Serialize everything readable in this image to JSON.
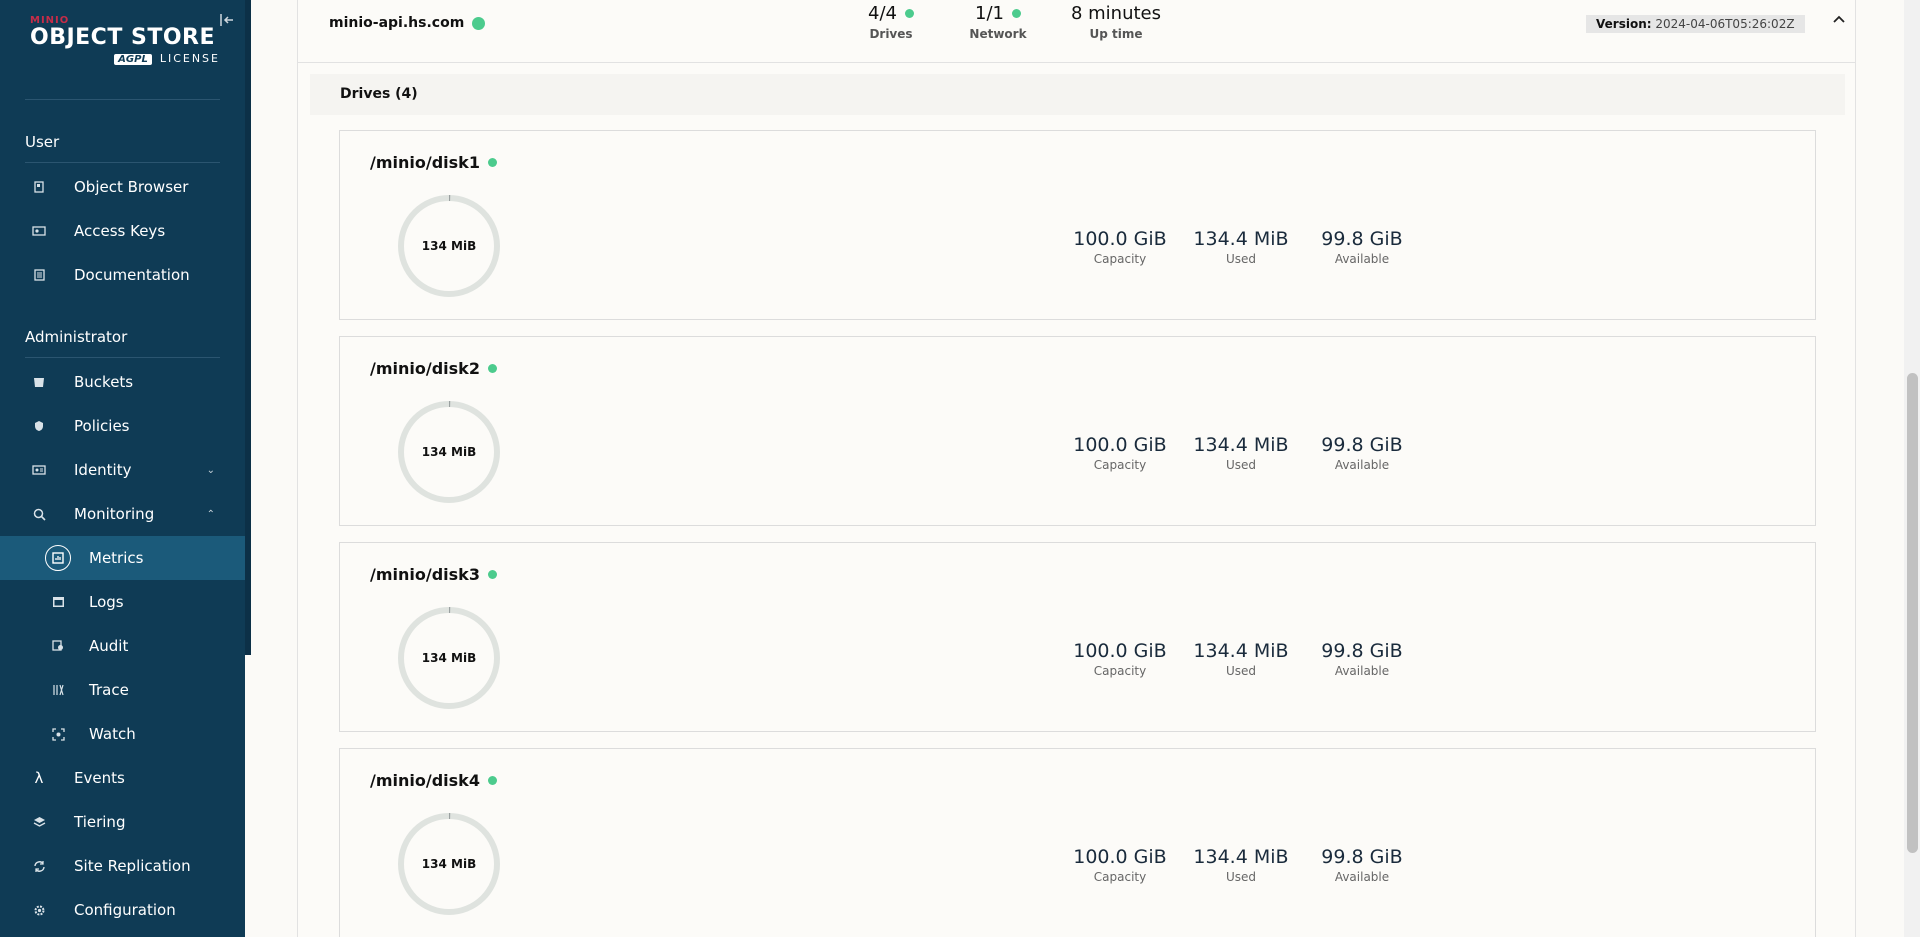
{
  "sidebar": {
    "logo": {
      "brand": "MINIO",
      "product": "OBJECT STORE",
      "license_badge": "AGPL",
      "license": "LICENSE"
    },
    "user_section": "User",
    "user_items": [
      {
        "label": "Object Browser",
        "icon": "object-browser-icon"
      },
      {
        "label": "Access Keys",
        "icon": "access-keys-icon"
      },
      {
        "label": "Documentation",
        "icon": "documentation-icon"
      }
    ],
    "admin_section": "Administrator",
    "admin_items": [
      {
        "label": "Buckets",
        "icon": "buckets-icon"
      },
      {
        "label": "Policies",
        "icon": "policies-icon"
      },
      {
        "label": "Identity",
        "icon": "identity-icon",
        "expandable": true,
        "expanded": false
      },
      {
        "label": "Monitoring",
        "icon": "monitoring-icon",
        "expandable": true,
        "expanded": true
      },
      {
        "label": "Metrics",
        "icon": "metrics-icon",
        "sub": true,
        "active": true
      },
      {
        "label": "Logs",
        "icon": "logs-icon",
        "sub": true
      },
      {
        "label": "Audit",
        "icon": "audit-icon",
        "sub": true
      },
      {
        "label": "Trace",
        "icon": "trace-icon",
        "sub": true
      },
      {
        "label": "Watch",
        "icon": "watch-icon",
        "sub": true
      },
      {
        "label": "Events",
        "icon": "lambda-icon"
      },
      {
        "label": "Tiering",
        "icon": "tiering-icon"
      },
      {
        "label": "Site Replication",
        "icon": "site-replication-icon"
      },
      {
        "label": "Configuration",
        "icon": "configuration-icon"
      }
    ]
  },
  "server": {
    "name": "minio-api.hs.com",
    "status_color": "#4ccb8d",
    "drives": {
      "value": "4/4",
      "label": "Drives"
    },
    "network": {
      "value": "1/1",
      "label": "Network"
    },
    "uptime": {
      "value": "8 minutes",
      "label": "Up time"
    },
    "version_label": "Version:",
    "version_value": "2024-04-06T05:26:02Z"
  },
  "drives_section": {
    "title": "Drives (4)"
  },
  "drives": [
    {
      "path": "/minio/disk1",
      "usage_label": "134 MiB",
      "capacity": "100.0 GiB",
      "capacity_label": "Capacity",
      "used": "134.4 MiB",
      "used_label": "Used",
      "available": "99.8 GiB",
      "available_label": "Available",
      "used_fraction": 0.0013
    },
    {
      "path": "/minio/disk2",
      "usage_label": "134 MiB",
      "capacity": "100.0 GiB",
      "capacity_label": "Capacity",
      "used": "134.4 MiB",
      "used_label": "Used",
      "available": "99.8 GiB",
      "available_label": "Available",
      "used_fraction": 0.0013
    },
    {
      "path": "/minio/disk3",
      "usage_label": "134 MiB",
      "capacity": "100.0 GiB",
      "capacity_label": "Capacity",
      "used": "134.4 MiB",
      "used_label": "Used",
      "available": "99.8 GiB",
      "available_label": "Available",
      "used_fraction": 0.0013
    },
    {
      "path": "/minio/disk4",
      "usage_label": "134 MiB",
      "capacity": "100.0 GiB",
      "capacity_label": "Capacity",
      "used": "134.4 MiB",
      "used_label": "Used",
      "available": "99.8 GiB",
      "available_label": "Available",
      "used_fraction": 0.0013
    }
  ]
}
